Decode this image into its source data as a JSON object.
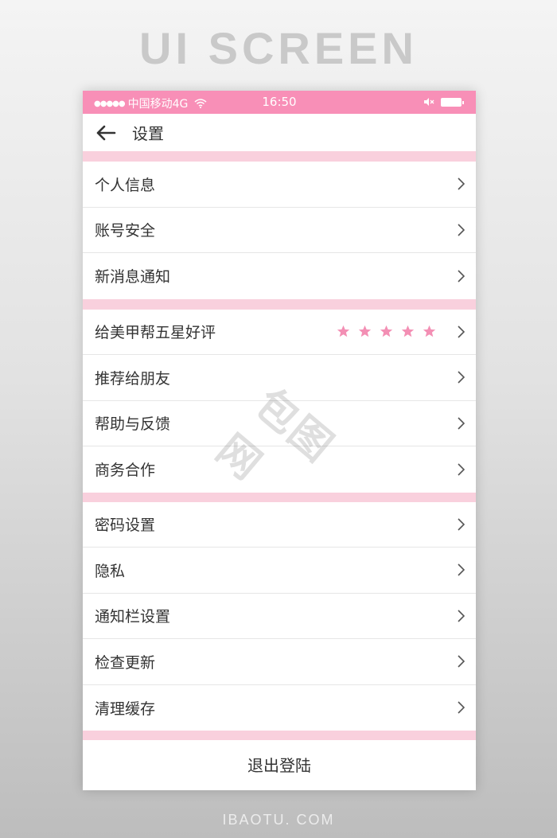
{
  "page": {
    "header": "UI SCREEN",
    "footer": "IBAOTU. COM",
    "watermark": "包图网"
  },
  "status_bar": {
    "dots": "●●●●●",
    "carrier": "中国移动4G",
    "time": "16:50"
  },
  "nav": {
    "title": "设置"
  },
  "groups": [
    {
      "items": [
        "个人信息",
        "账号安全",
        "新消息通知"
      ]
    },
    {
      "items": [
        "给美甲帮五星好评",
        "推荐给朋友",
        "帮助与反馈",
        "商务合作"
      ]
    },
    {
      "items": [
        "密码设置",
        "隐私",
        "通知栏设置",
        "检查更新",
        "清理缓存"
      ]
    }
  ],
  "rating": {
    "stars": 5,
    "color": "#f38fb4"
  },
  "logout": {
    "label": "退出登陆"
  },
  "colors": {
    "status_bar": "#f88fb7",
    "divider": "#f9d0dd"
  }
}
